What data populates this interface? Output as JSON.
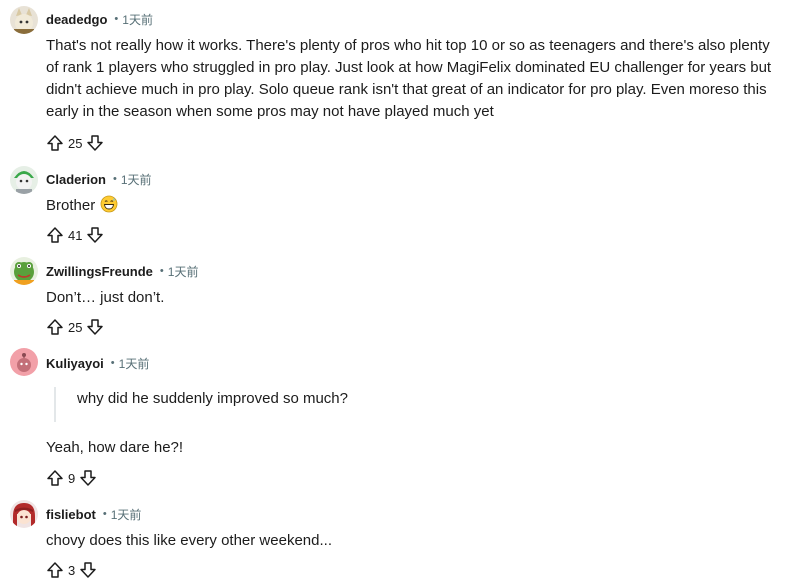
{
  "comments": [
    {
      "author": "deadedgo",
      "time": "1天前",
      "body": "That's not really how it works. There's plenty of pros who hit top 10 or so as teenagers and there's also plenty of rank 1 players who struggled in pro play. Just look at how MagiFelix dominated EU challenger for years but didn't achieve much in pro play. Solo queue rank isn't that great of an indicator for pro play. Even moreso this early in the season when some pros may not have played much yet",
      "score": "25"
    },
    {
      "author": "Claderion",
      "time": "1天前",
      "body": "Brother",
      "emoji": "grinning-sweat-emoji",
      "score": "41"
    },
    {
      "author": "ZwillingsFreunde",
      "time": "1天前",
      "body": "Don’t… just don’t.",
      "score": "25"
    },
    {
      "author": "Kuliyayoi",
      "time": "1天前",
      "quote": "why did he suddenly improved so much?",
      "body": "Yeah, how dare he?!",
      "score": "9"
    },
    {
      "author": "fisliebot",
      "time": "1天前",
      "body": "chovy does this like every other weekend...",
      "score": "3"
    }
  ],
  "icons": {
    "upvote": "upvote-arrow-icon",
    "downvote": "downvote-arrow-icon"
  },
  "colors": {
    "text": "#1c1c1c",
    "meta": "#576f76",
    "quote_border": "#e3e7e9"
  }
}
